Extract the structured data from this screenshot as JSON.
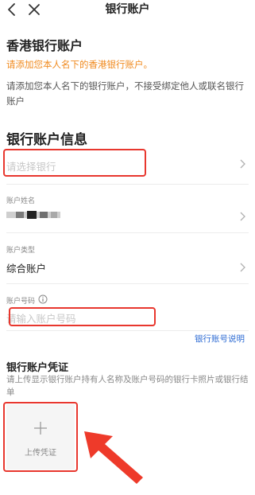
{
  "header": {
    "title": "银行账户"
  },
  "hk_section": {
    "title": "香港银行账户",
    "notice": "请添加您本人名下的香港银行账户。",
    "description": "请添加您本人名下的银行账户，不接受绑定他人或联名银行账户"
  },
  "info_section": {
    "title": "银行账户信息",
    "bank_select": {
      "placeholder": "请选择银行"
    },
    "holder_name": {
      "label": "账户姓名"
    },
    "account_type": {
      "label": "账户类型",
      "value": "综合账户"
    },
    "account_number": {
      "label": "账户号码",
      "placeholder": "请输入账户号码"
    },
    "help_link": "银行账号说明"
  },
  "proof_section": {
    "title": "银行账户凭证",
    "description": "请上传显示银行账户持有人名称及账户号码的银行卡照片或银行结单",
    "upload_label": "上传凭证"
  },
  "colors": {
    "highlight": "#e8372e",
    "notice": "#f08a1e",
    "link": "#2d6bd3"
  },
  "icons": [
    "back-icon",
    "close-icon",
    "chevron-right-icon",
    "info-icon",
    "plus-icon",
    "arrow-icon"
  ]
}
